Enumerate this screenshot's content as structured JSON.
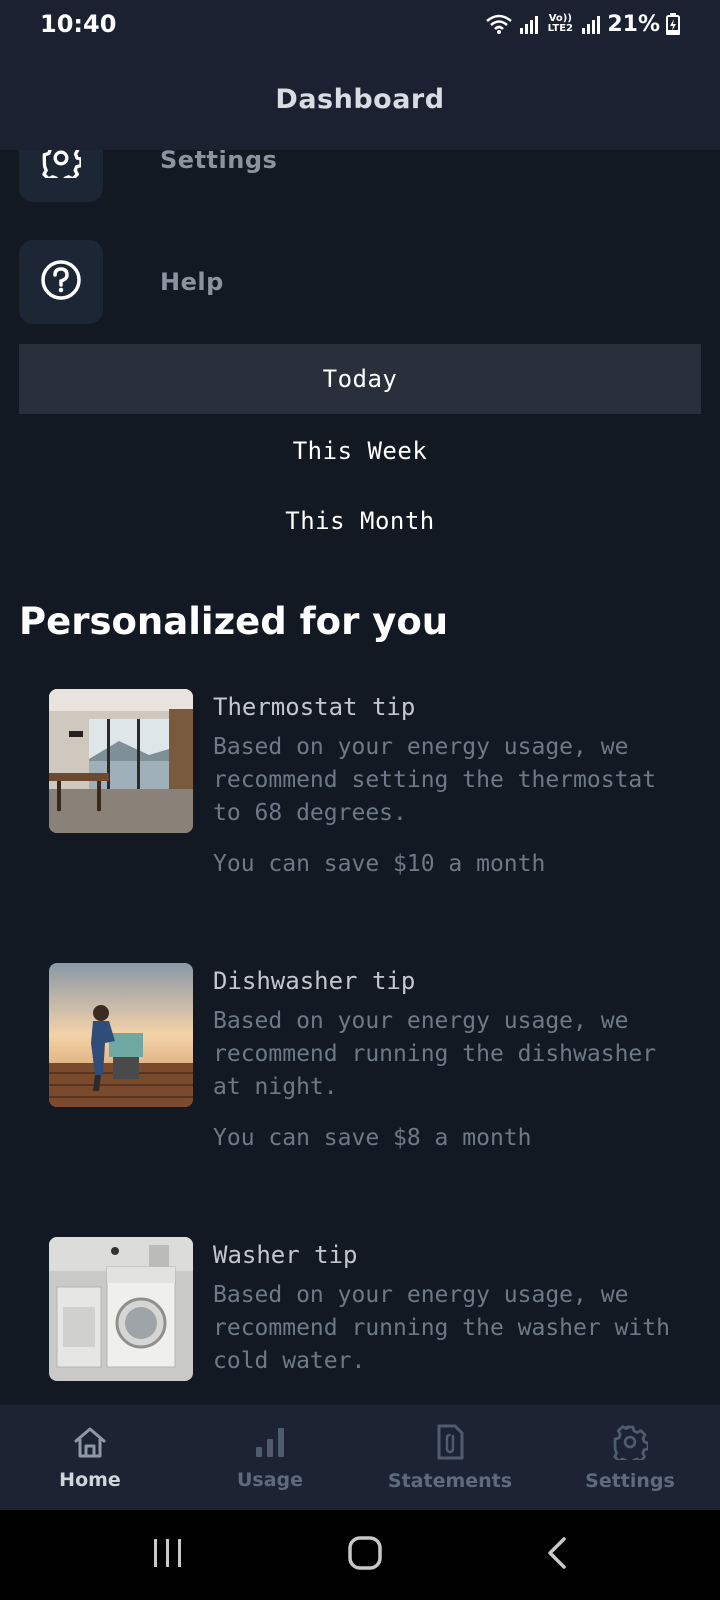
{
  "status_bar": {
    "time": "10:40",
    "network_label": "Vo)) LTE2",
    "battery": "21%"
  },
  "app_bar": {
    "title": "Dashboard"
  },
  "menu": [
    {
      "label": "Settings",
      "icon": "gear-icon"
    },
    {
      "label": "Help",
      "icon": "help-circle-icon"
    }
  ],
  "periods": [
    {
      "label": "Today",
      "selected": true
    },
    {
      "label": "This Week",
      "selected": false
    },
    {
      "label": "This Month",
      "selected": false
    }
  ],
  "section": {
    "title": "Personalized for you"
  },
  "tips": [
    {
      "title": "Thermostat tip",
      "body": "Based on your energy usage, we recommend setting the thermostat to 68 degrees.",
      "savings": "You can save $10 a month",
      "image": "living-room-photo"
    },
    {
      "title": "Dishwasher tip",
      "body": "Based on your energy usage, we recommend running the dishwasher at night.",
      "savings": "You can save $8 a month",
      "image": "person-at-dishwasher-photo"
    },
    {
      "title": "Washer tip",
      "body": "Based on your energy usage, we recommend running the washer with cold water.",
      "image": "washing-machine-photo"
    }
  ],
  "bottom_nav": [
    {
      "label": "Home",
      "icon": "home-icon",
      "active": true
    },
    {
      "label": "Usage",
      "icon": "bar-chart-icon",
      "active": false
    },
    {
      "label": "Statements",
      "icon": "document-clip-icon",
      "active": false
    },
    {
      "label": "Settings",
      "icon": "gear-icon",
      "active": false
    }
  ],
  "colors": {
    "background": "#131923",
    "app_bar": "#1b2130",
    "selected_period": "#2a303b",
    "muted_text": "#6e7987",
    "nav_inactive": "#5e6b7b"
  }
}
